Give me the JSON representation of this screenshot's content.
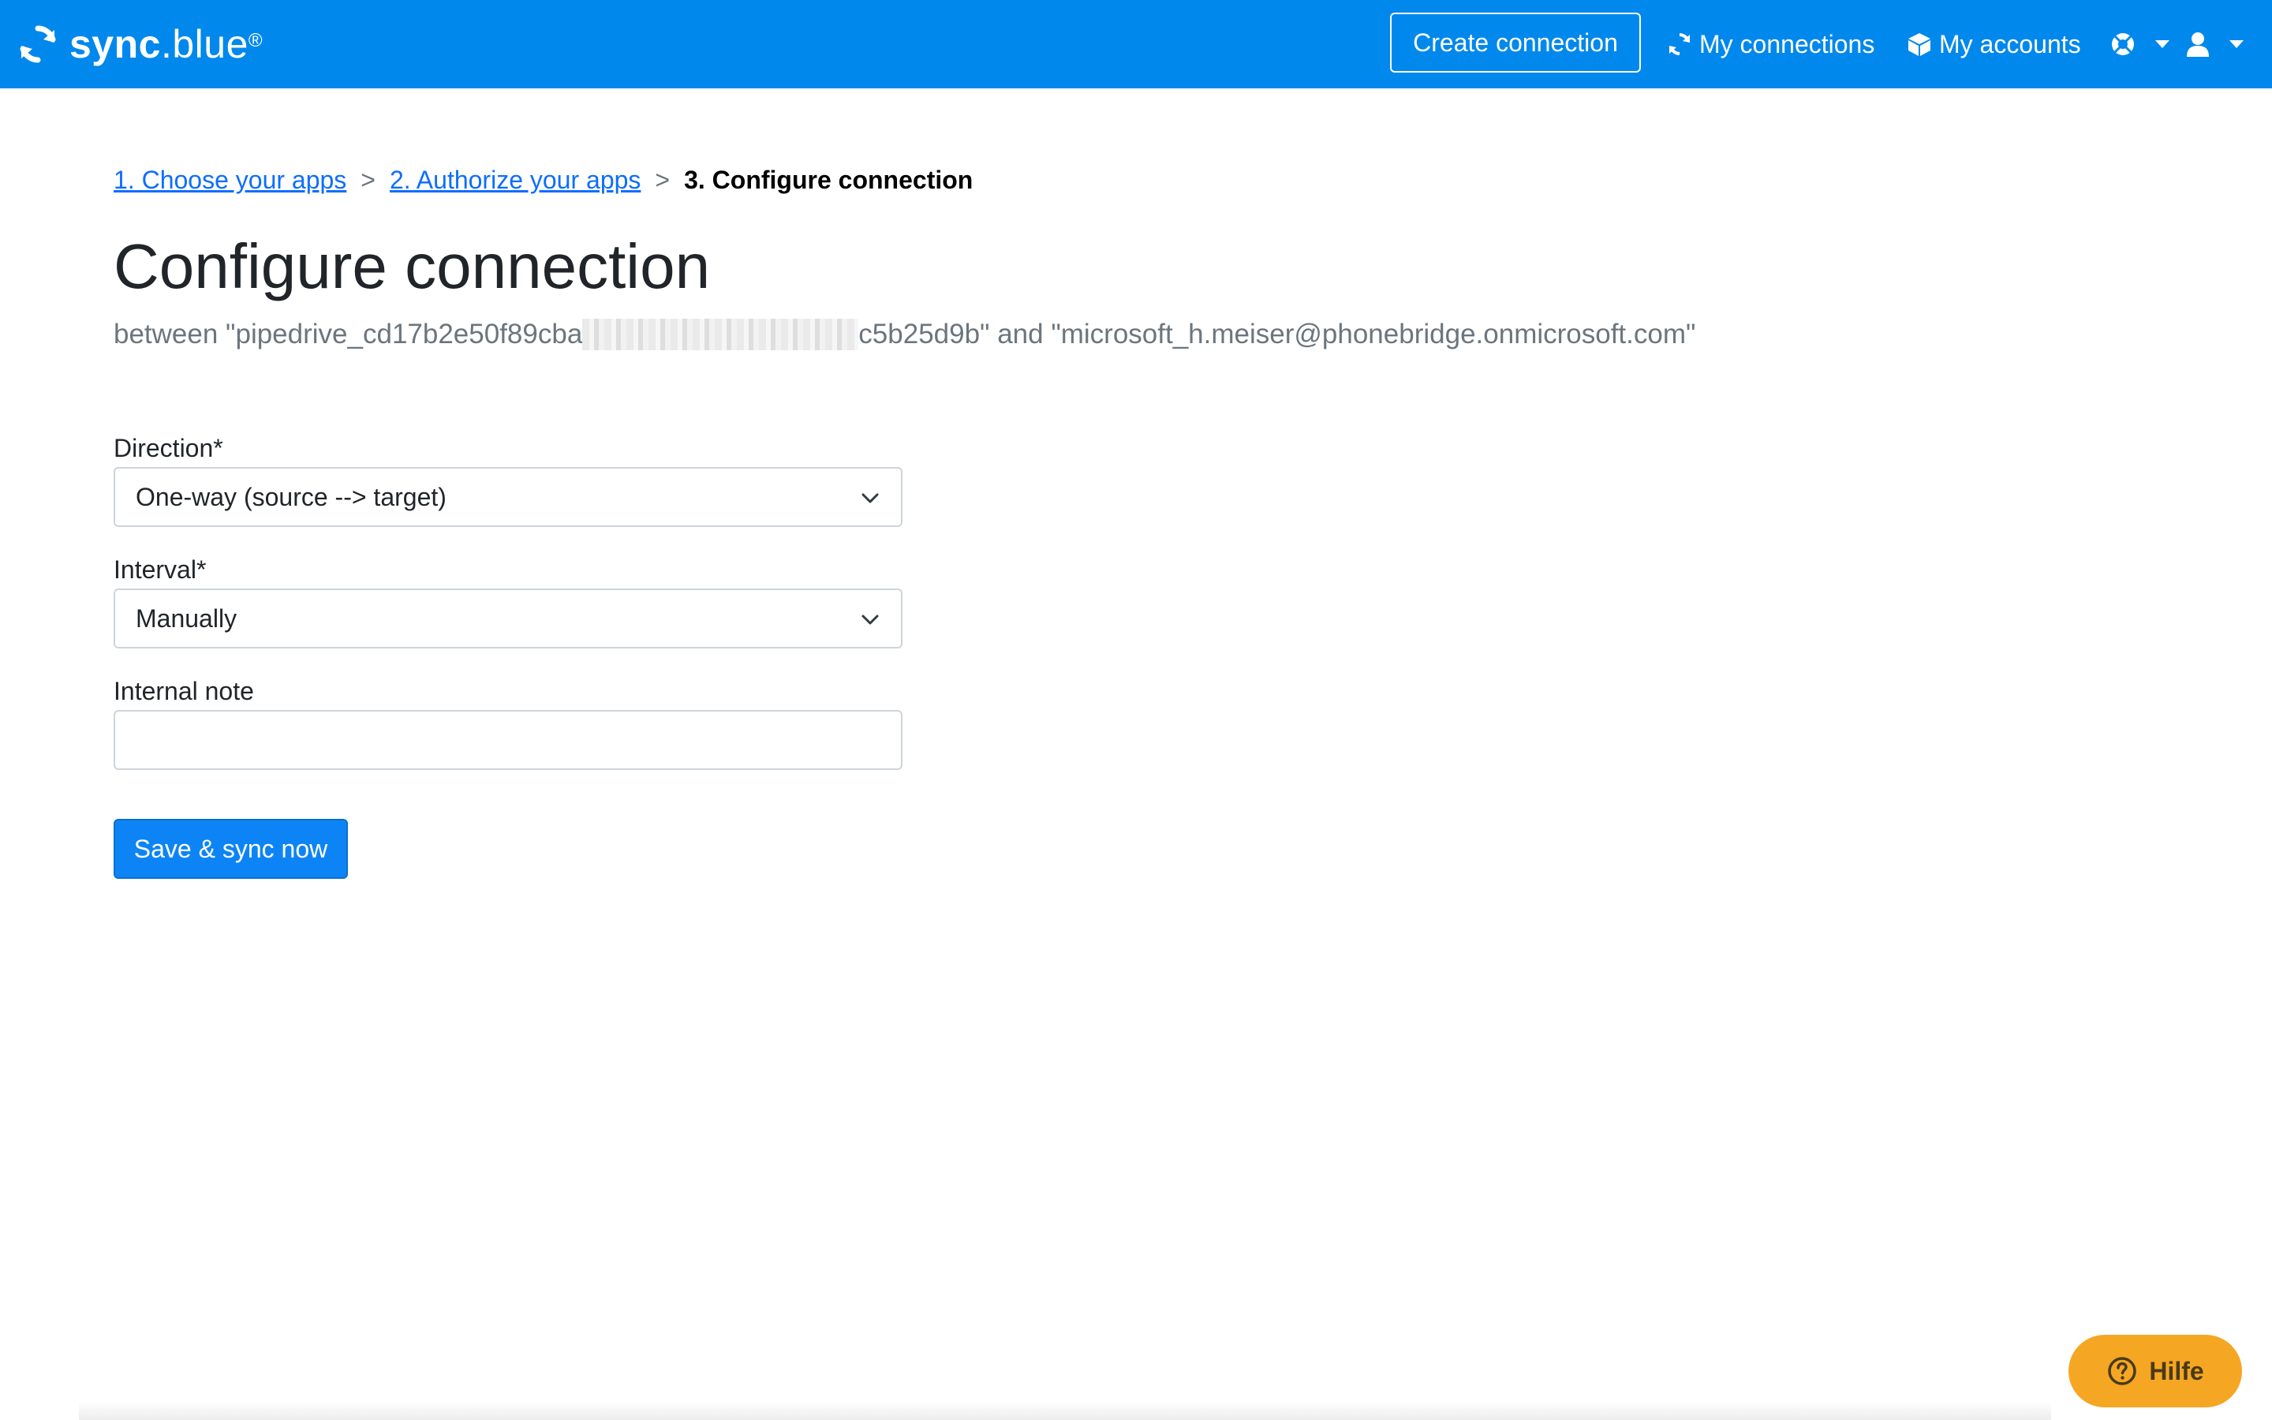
{
  "brand": {
    "name_bold": "sync",
    "name_rest": ".blue",
    "trademark": "®"
  },
  "navbar": {
    "create_button": "Create connection",
    "my_connections": "My connections",
    "my_accounts": "My accounts",
    "icons": {
      "connections": "sync-icon",
      "accounts": "box-icon",
      "help": "lifebuoy-icon",
      "user": "user-icon"
    }
  },
  "breadcrumb": {
    "step1": "1. Choose your apps",
    "step2": "2. Authorize your apps",
    "step3": "3. Configure connection",
    "separator": ">"
  },
  "page": {
    "title": "Configure connection",
    "subtitle_prefix": "between \"pipedrive_cd17b2e50f89cba",
    "subtitle_suffix": "c5b25d9b\" and \"microsoft_h.meiser@phonebridge.onmicrosoft.com\""
  },
  "form": {
    "direction_label": "Direction*",
    "direction_value": "One-way (source --> target)",
    "interval_label": "Interval*",
    "interval_value": "Manually",
    "note_label": "Internal note",
    "note_value": "",
    "submit_label": "Save & sync now"
  },
  "help_widget": {
    "label": "Hilfe"
  },
  "colors": {
    "navbar": "#0088ec",
    "primary": "#0d84f5",
    "link": "#0d6efd",
    "help_button": "#f5a623"
  }
}
